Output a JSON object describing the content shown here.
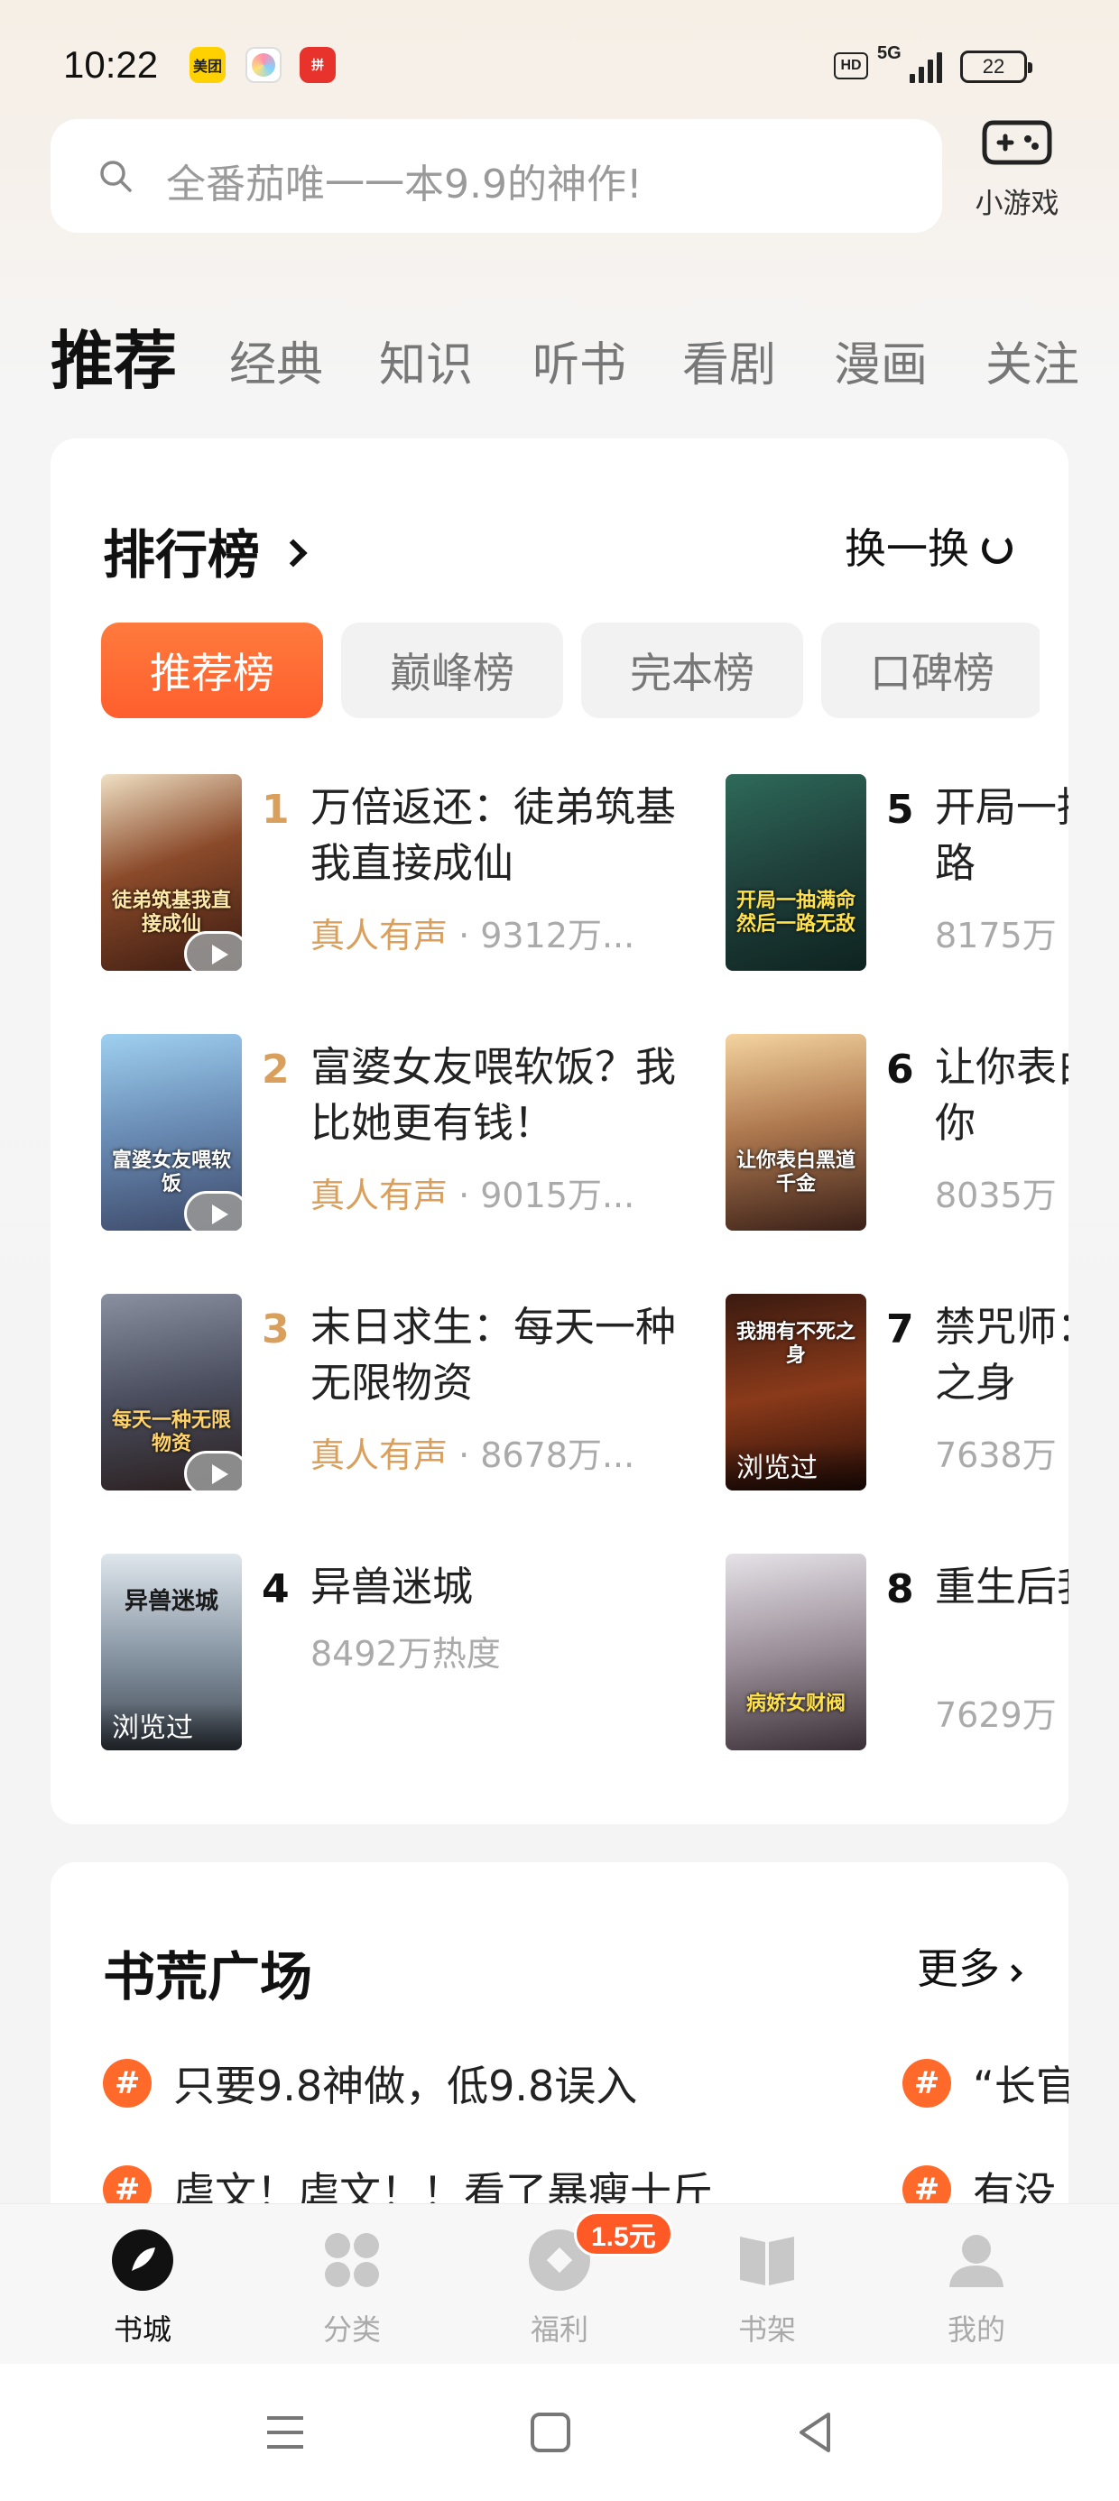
{
  "status_bar": {
    "time": "10:22",
    "app_icons": [
      "美团",
      "camera",
      "拼多多"
    ],
    "hd": "HD",
    "network": "5G",
    "battery": "22"
  },
  "search": {
    "placeholder": "全番茄唯一一本9.9的神作!"
  },
  "mini_game": {
    "label": "小游戏"
  },
  "categories": [
    "推荐",
    "经典",
    "知识",
    "听书",
    "看剧",
    "漫画",
    "关注"
  ],
  "ranking": {
    "title": "排行榜",
    "refresh_label": "换一换",
    "tabs": [
      "推荐榜",
      "巅峰榜",
      "完本榜",
      "口碑榜"
    ],
    "books": [
      {
        "rank": "1",
        "title": "万倍返还：徒弟筑基我直接成仙",
        "voice": "真人有声",
        "meta": " · 9312万...",
        "cover_text": "徒弟筑基我直接成仙"
      },
      {
        "rank": "2",
        "title": "富婆女友喂软饭？我比她更有钱！",
        "voice": "真人有声",
        "meta": " · 9015万...",
        "cover_text": "富婆女友喂软饭"
      },
      {
        "rank": "3",
        "title": "末日求生：每天一种无限物资",
        "voice": "真人有声",
        "meta": " · 8678万...",
        "cover_text": "每天一种无限物资"
      },
      {
        "rank": "4",
        "title": "异兽迷城",
        "meta": "8492万热度",
        "cover_text": "异兽迷城",
        "seen": "浏览过"
      },
      {
        "rank": "5",
        "title": "开局一抽满命然后一路",
        "meta": "8175万",
        "cover_text": "开局一抽满命然后一路无敌"
      },
      {
        "rank": "6",
        "title": "让你表白黑道千金，你",
        "meta": "8035万",
        "cover_text": "让你表白黑道千金"
      },
      {
        "rank": "7",
        "title": "禁咒师：我拥有不死之身",
        "meta": "7638万",
        "cover_text": "我拥有不死之身",
        "seen": "浏览过"
      },
      {
        "rank": "8",
        "title": "重生后我的财阀老婆",
        "meta": "7629万",
        "cover_text": "病娇女财阀"
      }
    ]
  },
  "plaza": {
    "title": "书荒广场",
    "more_label": "更多",
    "topics": [
      "只要9.8神做，低9.8误入",
      "“长官",
      "虐文！虐文！！看了暴瘦十斤",
      "有没"
    ]
  },
  "bottom_nav": {
    "items": [
      "书城",
      "分类",
      "福利",
      "书架",
      "我的"
    ],
    "badge": "1.5元"
  },
  "colors": {
    "accent": "#ff6a2b",
    "gold": "#d8a05c"
  }
}
